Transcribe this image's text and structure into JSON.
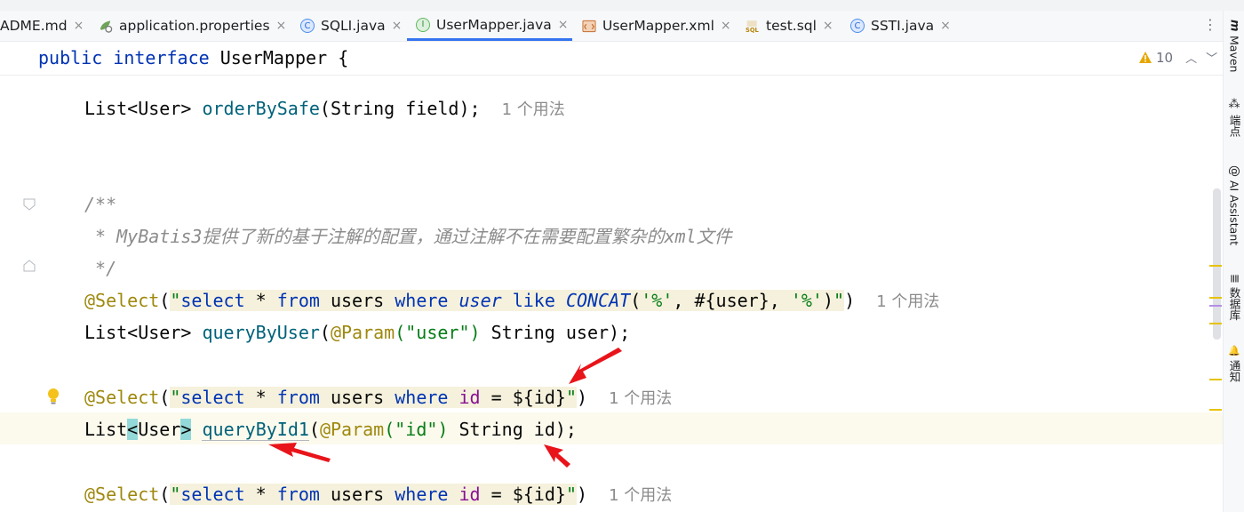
{
  "tabs": [
    {
      "label": "ADME.md",
      "icon": "markdown-icon",
      "active": false
    },
    {
      "label": "application.properties",
      "icon": "properties-icon",
      "active": false
    },
    {
      "label": "SQLI.java",
      "icon": "java-class-icon",
      "active": false
    },
    {
      "label": "UserMapper.java",
      "icon": "java-interface-icon",
      "active": true
    },
    {
      "label": "UserMapper.xml",
      "icon": "xml-icon",
      "active": false
    },
    {
      "label": "test.sql",
      "icon": "sql-icon",
      "active": false
    },
    {
      "label": "SSTI.java",
      "icon": "java-class-icon",
      "active": false
    }
  ],
  "tab_close_glyph": "×",
  "sticky": {
    "kw1": "public",
    "kw2": "interface",
    "name": "UserMapper",
    "brace": "{"
  },
  "inspection": {
    "warning_count": "10"
  },
  "code": {
    "l1": {
      "type": "List<User> ",
      "method": "orderBySafe",
      "params": "(String field);",
      "usage": "1 个用法"
    },
    "doc_open": "/**",
    "doc_body": " * MyBatis3提供了新的基于注解的配置，通过注解不在需要配置繁杂的xml文件",
    "doc_close": " */",
    "sel1": {
      "anno": "@Select",
      "open": "(",
      "q1": "\"",
      "select": "select",
      "star": " * ",
      "from": "from",
      "users": " users ",
      "where": "where",
      "sp1": " ",
      "user_col": "user",
      "sp2": " ",
      "like": "like",
      "sp3": " ",
      "concat": "CONCAT",
      "p_open": "(",
      "pct1": "'%'",
      "comma1": ", ",
      "param": "#{user}",
      "comma2": ", ",
      "pct2": "'%'",
      "p_close": ")",
      "q2": "\"",
      "close": ")",
      "usage": "1 个用法"
    },
    "m2": {
      "type": "List<User> ",
      "method": "queryByUser",
      "open": "(",
      "anno": "@Param",
      "arg": "(\"user\")",
      "rest": " String user);"
    },
    "sel2": {
      "anno": "@Select",
      "open": "(",
      "q1": "\"",
      "select": "select",
      "star": " * ",
      "from": "from",
      "users": " users ",
      "where": "where",
      "sp1": " ",
      "id_col": "id",
      "eq": " = ",
      "param": "${id}",
      "q2": "\"",
      "close": ")",
      "usage": "1 个用法"
    },
    "m3": {
      "list": "List",
      "lt": "<",
      "user": "User",
      "gt": ">",
      "sp": " ",
      "method": "queryById1",
      "open": "(",
      "anno": "@Param",
      "arg": "(\"id\")",
      "rest": " String id);"
    },
    "sel3": {
      "anno": "@Select",
      "open": "(",
      "q1": "\"",
      "select": "select",
      "star": " * ",
      "from": "from",
      "users": " users ",
      "where": "where",
      "sp1": " ",
      "id_col": "id",
      "eq": " = ",
      "param": "${id}",
      "q2": "\"",
      "close": ")",
      "usage": "1 个用法"
    }
  },
  "right_panels": [
    {
      "label": "Maven",
      "icon": "maven-icon",
      "glyph": "m"
    },
    {
      "label": "端点",
      "icon": "endpoints-icon",
      "glyph": "⁂"
    },
    {
      "label": "AI Assistant",
      "icon": "ai-assistant-icon",
      "glyph": "@"
    },
    {
      "label": "数据库",
      "icon": "database-icon",
      "glyph": "≣"
    },
    {
      "label": "通知",
      "icon": "bell-icon",
      "glyph": "🔔"
    }
  ],
  "colors": {
    "accent": "#3574f0",
    "annotation_arrow": "#e8141a",
    "warning": "#e6a700"
  }
}
